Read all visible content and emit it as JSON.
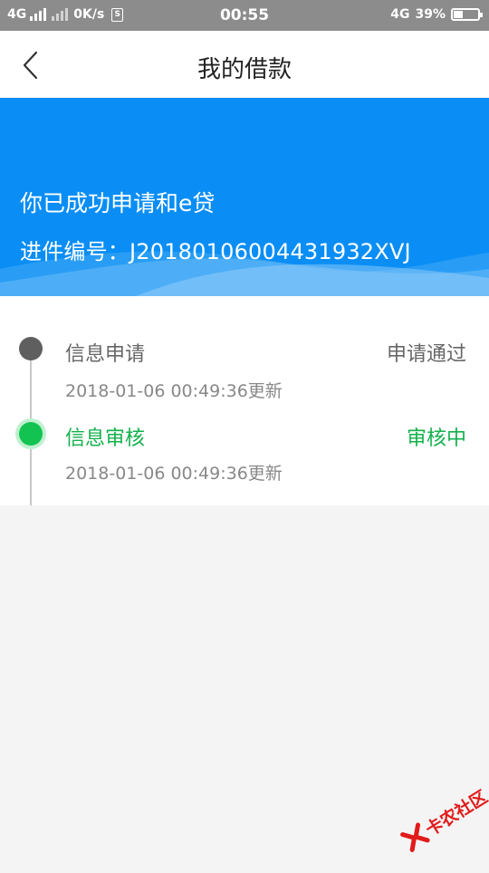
{
  "status_bar": {
    "network1": "4G",
    "speed": "0K/s",
    "sim_glyph": "S",
    "time": "00:55",
    "network2": "4G",
    "battery_percent": "39%",
    "battery_level": 0.39
  },
  "header": {
    "title": "我的借款",
    "back_icon": "chevron-left-icon"
  },
  "banner": {
    "title": "你已成功申请和e贷",
    "application_label": "进件编号：",
    "application_number": "J20180106004431932XVJ",
    "color": "#0a8ef5"
  },
  "timeline": {
    "steps": [
      {
        "name": "信息申请",
        "status": "申请通过",
        "time": "2018-01-06 00:49:36更新",
        "color": "#666666"
      },
      {
        "name": "信息审核",
        "status": "审核中",
        "time": "2018-01-06 00:49:36更新",
        "color": "#13b14c"
      }
    ]
  },
  "watermark": {
    "text": "卡农社区"
  }
}
